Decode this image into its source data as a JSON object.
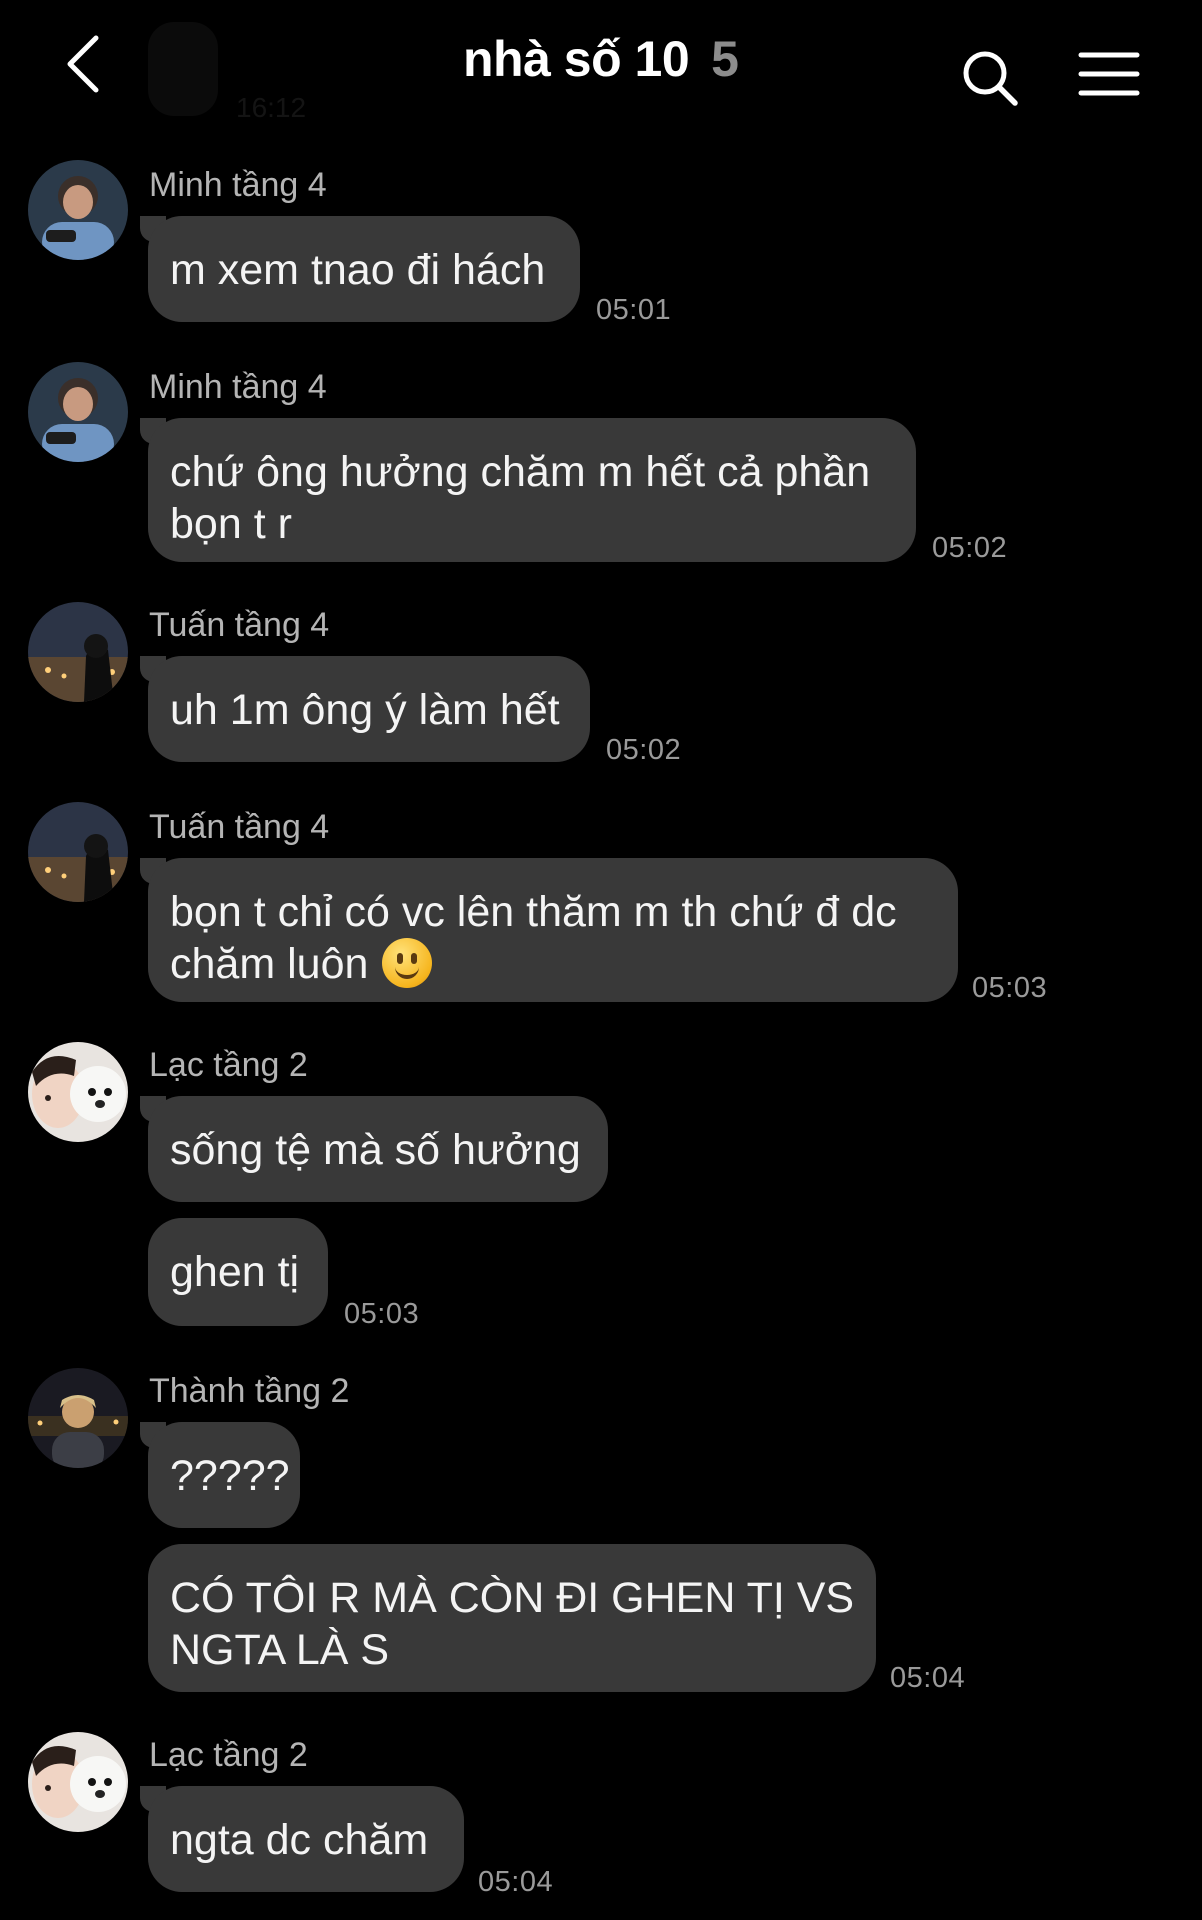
{
  "header": {
    "title": "nhà số 10",
    "member_count": "5",
    "prev_time": "16:12",
    "icons": {
      "back": "chevron-left-icon",
      "search": "search-icon",
      "menu": "hamburger-menu-icon"
    }
  },
  "messages": [
    {
      "sender": "Minh tầng 4",
      "avatar": "avatar-minh",
      "text": "m xem tnao đi hách",
      "time": "05:01"
    },
    {
      "sender": "Minh tầng 4",
      "avatar": "avatar-minh",
      "lines": [
        "chứ ông hưởng chăm m hết cả phần",
        "bọn t r"
      ],
      "time": "05:02"
    },
    {
      "sender": "Tuấn tầng 4",
      "avatar": "avatar-tuan",
      "text": "uh 1m ông ý làm hết",
      "time": "05:02"
    },
    {
      "sender": "Tuấn tầng 4",
      "avatar": "avatar-tuan",
      "lines": [
        "bọn t chỉ có vc lên thăm m th chứ đ dc",
        "chăm luôn"
      ],
      "emoji": "slightly-smiling-face",
      "time": "05:03"
    },
    {
      "sender": "Lạc tầng 2",
      "avatar": "avatar-lac",
      "text": "sống tệ mà số hưởng"
    },
    {
      "text": "ghen tị",
      "time": "05:03"
    },
    {
      "sender": "Thành tầng 2",
      "avatar": "avatar-thanh",
      "text": "?????"
    },
    {
      "lines": [
        "CÓ TÔI R MÀ CÒN ĐI GHEN TỊ VS",
        "NGTA LÀ S"
      ],
      "time": "05:04"
    },
    {
      "sender": "Lạc tầng 2",
      "avatar": "avatar-lac",
      "text": "ngta dc chăm",
      "time": "05:04"
    }
  ]
}
